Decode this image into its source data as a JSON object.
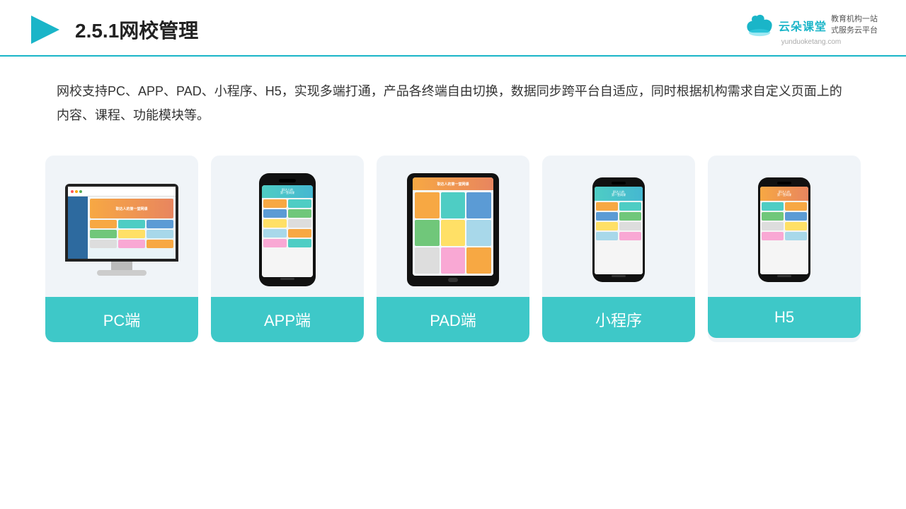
{
  "header": {
    "title": "2.5.1网校管理",
    "logo_text_cn": "云朵课堂",
    "logo_domain": "yunduoketang.com",
    "logo_tagline_line1": "教育机构一站",
    "logo_tagline_line2": "式服务云平台"
  },
  "description": {
    "text": "网校支持PC、APP、PAD、小程序、H5，实现多端打通，产品各终端自由切换，数据同步跨平台自适应，同时根据机构需求自定义页面上的内容、课程、功能模块等。"
  },
  "cards": [
    {
      "id": "pc",
      "label": "PC端",
      "device_type": "pc"
    },
    {
      "id": "app",
      "label": "APP端",
      "device_type": "phone"
    },
    {
      "id": "pad",
      "label": "PAD端",
      "device_type": "ipad"
    },
    {
      "id": "miniprogram",
      "label": "小程序",
      "device_type": "phone_small"
    },
    {
      "id": "h5",
      "label": "H5",
      "device_type": "phone_small"
    }
  ]
}
